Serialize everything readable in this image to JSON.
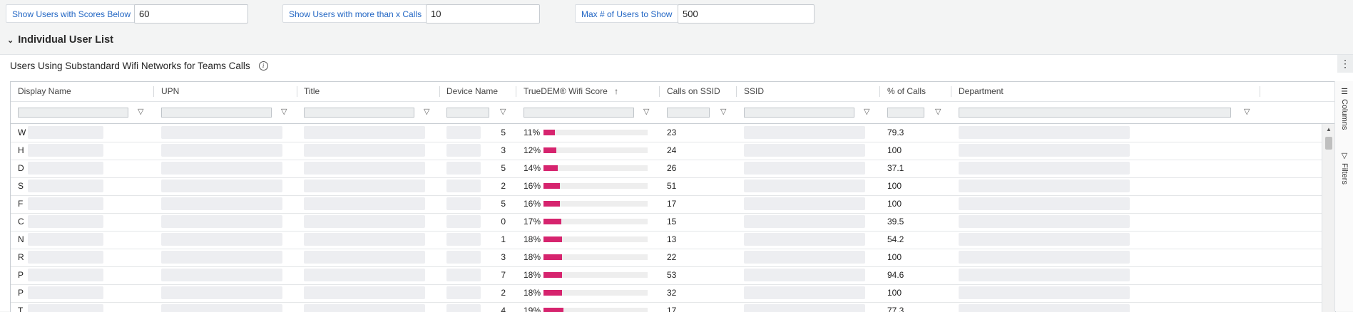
{
  "filters": [
    {
      "label": "Show Users with Scores Below",
      "value": "60"
    },
    {
      "label": "Show Users with more than x Calls",
      "value": "10"
    },
    {
      "label": "Max # of Users to Show",
      "value": "500"
    }
  ],
  "section": {
    "title": "Individual User List"
  },
  "panel": {
    "title": "Users Using Substandard Wifi Networks for Teams Calls"
  },
  "columns": [
    "Display Name",
    "UPN",
    "Title",
    "Device Name",
    "TrueDEM® Wifi Score",
    "Calls on SSID",
    "SSID",
    "% of Calls",
    "Department"
  ],
  "sort_indicator": "↑",
  "side_tabs": {
    "columns": "Columns",
    "filters": "Filters"
  },
  "rows": [
    {
      "name": "W",
      "device": "5",
      "score": "11%",
      "score_pct": 11,
      "calls": "23",
      "pct": "79.3"
    },
    {
      "name": "H",
      "device": "3",
      "score": "12%",
      "score_pct": 12,
      "calls": "24",
      "pct": "100"
    },
    {
      "name": "D",
      "device": "5",
      "score": "14%",
      "score_pct": 14,
      "calls": "26",
      "pct": "37.1"
    },
    {
      "name": "S",
      "device": "2",
      "score": "16%",
      "score_pct": 16,
      "calls": "51",
      "pct": "100"
    },
    {
      "name": "F",
      "device": "5",
      "score": "16%",
      "score_pct": 16,
      "calls": "17",
      "pct": "100"
    },
    {
      "name": "C",
      "device": "0",
      "score": "17%",
      "score_pct": 17,
      "calls": "15",
      "pct": "39.5"
    },
    {
      "name": "N",
      "device": "1",
      "score": "18%",
      "score_pct": 18,
      "calls": "13",
      "pct": "54.2"
    },
    {
      "name": "R",
      "device": "3",
      "score": "18%",
      "score_pct": 18,
      "calls": "22",
      "pct": "100"
    },
    {
      "name": "P",
      "device": "7",
      "score": "18%",
      "score_pct": 18,
      "calls": "53",
      "pct": "94.6"
    },
    {
      "name": "P",
      "device": "2",
      "score": "18%",
      "score_pct": 18,
      "calls": "32",
      "pct": "100"
    },
    {
      "name": "T",
      "device": "4",
      "score": "19%",
      "score_pct": 19,
      "calls": "17",
      "pct": "77.3"
    }
  ],
  "colors": {
    "accent": "#2367c4",
    "bar": "#d6246e"
  }
}
